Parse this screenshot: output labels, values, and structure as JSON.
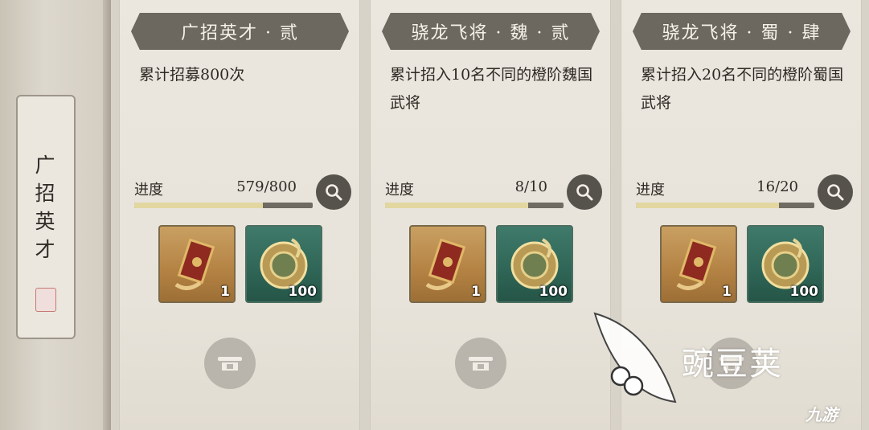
{
  "side_tab": {
    "label_chars": [
      "广",
      "招",
      "英",
      "才"
    ]
  },
  "cards": [
    {
      "title": "广招英才 · 贰",
      "description": "累计招募800次",
      "progress_label": "进度",
      "progress_text": "579/800",
      "progress_fraction": 0.72,
      "rewards": [
        {
          "type": "gold",
          "icon": "recruit-order-icon",
          "qty": "1"
        },
        {
          "type": "green",
          "icon": "jade-dragon-coin-icon",
          "qty": "100"
        }
      ]
    },
    {
      "title": "骁龙飞将 · 魏 · 贰",
      "description": "累计招入10名不同的橙阶魏国武将",
      "progress_label": "进度",
      "progress_text": "8/10",
      "progress_fraction": 0.8,
      "rewards": [
        {
          "type": "gold",
          "icon": "recruit-order-icon",
          "qty": "1"
        },
        {
          "type": "green",
          "icon": "jade-dragon-coin-icon",
          "qty": "100"
        }
      ]
    },
    {
      "title": "骁龙飞将 · 蜀 · 肆",
      "description": "累计招入20名不同的橙阶蜀国武将",
      "progress_label": "进度",
      "progress_text": "16/20",
      "progress_fraction": 0.8,
      "rewards": [
        {
          "type": "gold",
          "icon": "recruit-order-icon",
          "qty": "1"
        },
        {
          "type": "green",
          "icon": "jade-dragon-coin-icon",
          "qty": "100"
        }
      ]
    }
  ],
  "watermark": {
    "text": "豌豆荚",
    "sub": "九游"
  },
  "colors": {
    "title_bar": "#6c675f",
    "progress_fill": "#e2d7a0",
    "card_bg": "#ebe7df"
  }
}
